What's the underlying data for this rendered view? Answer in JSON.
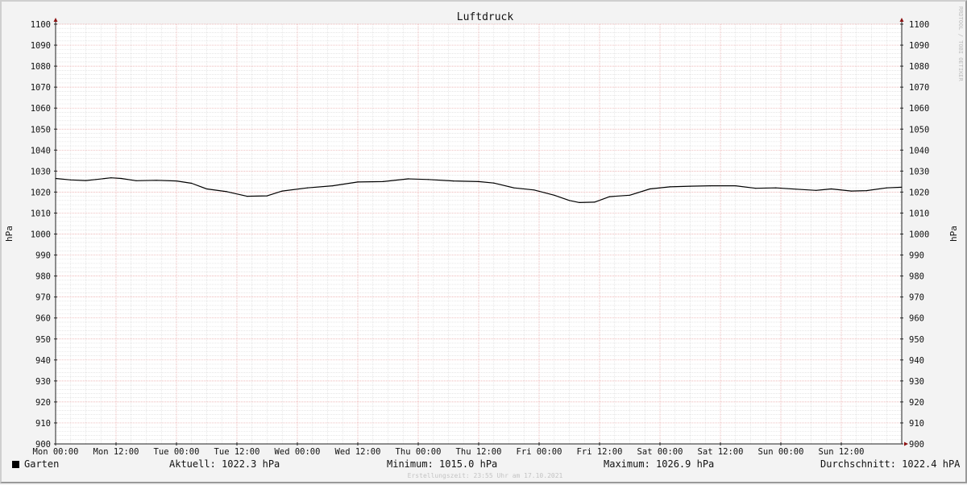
{
  "chart_data": {
    "type": "line",
    "title": "Luftdruck",
    "ylabel": "hPa",
    "ylim": [
      900,
      1100
    ],
    "y_ticks": [
      900,
      910,
      920,
      930,
      940,
      950,
      960,
      970,
      980,
      990,
      1000,
      1010,
      1020,
      1030,
      1040,
      1050,
      1060,
      1070,
      1080,
      1090,
      1100
    ],
    "x_range_hours": [
      0,
      168
    ],
    "x_ticks": [
      {
        "h": 0,
        "label": "Mon 00:00"
      },
      {
        "h": 12,
        "label": "Mon 12:00"
      },
      {
        "h": 24,
        "label": "Tue 00:00"
      },
      {
        "h": 36,
        "label": "Tue 12:00"
      },
      {
        "h": 48,
        "label": "Wed 00:00"
      },
      {
        "h": 60,
        "label": "Wed 12:00"
      },
      {
        "h": 72,
        "label": "Thu 00:00"
      },
      {
        "h": 84,
        "label": "Thu 12:00"
      },
      {
        "h": 96,
        "label": "Fri 00:00"
      },
      {
        "h": 108,
        "label": "Fri 12:00"
      },
      {
        "h": 120,
        "label": "Sat 00:00"
      },
      {
        "h": 132,
        "label": "Sat 12:00"
      },
      {
        "h": 144,
        "label": "Sun 00:00"
      },
      {
        "h": 156,
        "label": "Sun 12:00"
      }
    ],
    "grid": true,
    "series": [
      {
        "name": "Garten",
        "color": "#000000",
        "points": [
          [
            0,
            1026.5
          ],
          [
            3,
            1025.8
          ],
          [
            6,
            1025.5
          ],
          [
            8,
            1026.0
          ],
          [
            11,
            1026.8
          ],
          [
            13,
            1026.5
          ],
          [
            16,
            1025.4
          ],
          [
            20,
            1025.6
          ],
          [
            24,
            1025.3
          ],
          [
            27,
            1024.2
          ],
          [
            30,
            1021.5
          ],
          [
            34,
            1020.2
          ],
          [
            38,
            1018.0
          ],
          [
            42,
            1018.2
          ],
          [
            45,
            1020.5
          ],
          [
            50,
            1022.0
          ],
          [
            55,
            1023.0
          ],
          [
            60,
            1024.8
          ],
          [
            65,
            1025.0
          ],
          [
            70,
            1026.3
          ],
          [
            74,
            1026.0
          ],
          [
            79,
            1025.3
          ],
          [
            84,
            1025.0
          ],
          [
            87,
            1024.3
          ],
          [
            91,
            1022.0
          ],
          [
            95,
            1021.0
          ],
          [
            99,
            1018.5
          ],
          [
            102,
            1016.0
          ],
          [
            104,
            1015.0
          ],
          [
            107,
            1015.2
          ],
          [
            110,
            1017.8
          ],
          [
            114,
            1018.5
          ],
          [
            118,
            1021.5
          ],
          [
            122,
            1022.5
          ],
          [
            126,
            1022.8
          ],
          [
            130,
            1023.0
          ],
          [
            135,
            1023.0
          ],
          [
            139,
            1021.8
          ],
          [
            143,
            1022.0
          ],
          [
            147,
            1021.4
          ],
          [
            151,
            1020.8
          ],
          [
            154,
            1021.5
          ],
          [
            158,
            1020.5
          ],
          [
            161,
            1020.7
          ],
          [
            165,
            1022.0
          ],
          [
            168,
            1022.3
          ]
        ]
      }
    ]
  },
  "legend": {
    "series_label": "Garten",
    "series_color": "#000000",
    "current": "Aktuell: 1022.3 hPa",
    "minimum": "Minimum: 1015.0 hPa",
    "maximum": "Maximum: 1026.9 hPa",
    "average": "Durchschnitt: 1022.4 hPA"
  },
  "watermark": "RRDTOOL / TOBI OETIKER",
  "footer": "Erstellungszeit: 23:55 Uhr am 17.10.2021"
}
